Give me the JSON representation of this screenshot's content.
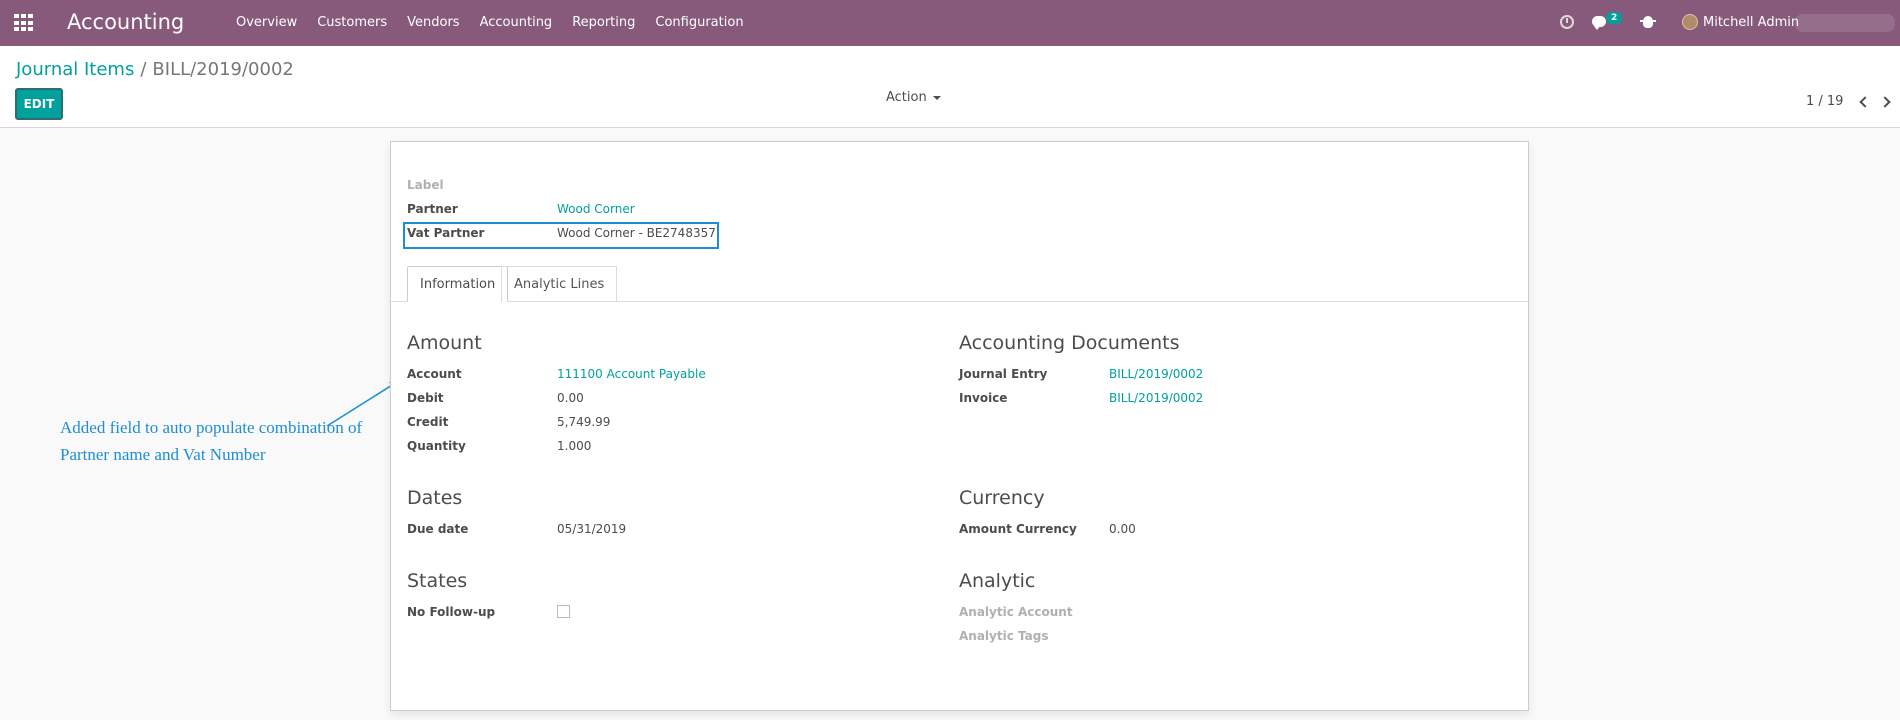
{
  "navbar": {
    "app_name": "Accounting",
    "menu": [
      "Overview",
      "Customers",
      "Vendors",
      "Accounting",
      "Reporting",
      "Configuration"
    ],
    "messages_count": "2",
    "user_name": "Mitchell Admin"
  },
  "control_panel": {
    "breadcrumb_parent": "Journal Items",
    "breadcrumb_separator": "/",
    "breadcrumb_current": "BILL/2019/0002",
    "edit_label": "EDIT",
    "action_label": "Action",
    "pager": "1 / 19"
  },
  "form": {
    "label_field": "Label",
    "partner_label": "Partner",
    "partner_value": "Wood Corner",
    "vat_partner_label": "Vat Partner",
    "vat_partner_value": "Wood Corner - BE2748357",
    "tabs": [
      "Information",
      "Analytic Lines"
    ],
    "amount": {
      "title": "Amount",
      "account_label": "Account",
      "account_value": "111100 Account Payable",
      "debit_label": "Debit",
      "debit_value": "0.00",
      "credit_label": "Credit",
      "credit_value": "5,749.99",
      "quantity_label": "Quantity",
      "quantity_value": "1.000"
    },
    "accounting_documents": {
      "title": "Accounting Documents",
      "journal_entry_label": "Journal Entry",
      "journal_entry_value": "BILL/2019/0002",
      "invoice_label": "Invoice",
      "invoice_value": "BILL/2019/0002"
    },
    "dates": {
      "title": "Dates",
      "due_date_label": "Due date",
      "due_date_value": "05/31/2019"
    },
    "currency": {
      "title": "Currency",
      "amount_currency_label": "Amount Currency",
      "amount_currency_value": "0.00"
    },
    "states": {
      "title": "States",
      "no_followup_label": "No Follow-up",
      "no_followup_checked": false
    },
    "analytic": {
      "title": "Analytic",
      "analytic_account_label": "Analytic Account",
      "analytic_tags_label": "Analytic Tags"
    }
  },
  "annotation": {
    "line1": "Added field to auto populate combination of",
    "line2": "Partner name and Vat Number",
    "color": "#1f8ed0"
  },
  "colors": {
    "navbar": "#875a7b",
    "accent": "#00a09d"
  }
}
